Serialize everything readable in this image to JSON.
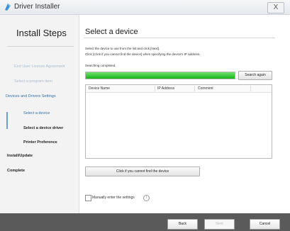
{
  "window": {
    "title": "Driver Installer",
    "close_label": "X"
  },
  "sidebar": {
    "title": "Install Steps",
    "steps": [
      {
        "label": "End User License Agreement",
        "state": "done"
      },
      {
        "label": "Select a program item",
        "state": "done"
      },
      {
        "label": "Devices and Drivers Settings",
        "state": "active-section"
      },
      {
        "label": "Select a device",
        "state": "current"
      },
      {
        "label": "Select a device driver",
        "state": "pending"
      },
      {
        "label": "Printer Preference",
        "state": "pending"
      },
      {
        "label": "Install/Update",
        "state": "pending"
      },
      {
        "label": "Complete",
        "state": "pending"
      }
    ]
  },
  "main": {
    "title": "Select a device",
    "instructions": [
      "Select the device to use from the list and click [Next].",
      "Click [Click if you cannot find the device] when specifying the device's IP address."
    ],
    "status": "Searching completed.",
    "progress_fraction": 1.0,
    "search_again_label": "Search again",
    "table": {
      "columns": [
        "Device Name",
        "IP Address",
        "Comment"
      ],
      "rows": []
    },
    "find_device_label": "Click if you cannot find the device",
    "manual_checkbox_label": "Manually enter the settings",
    "manual_checkbox_checked": false,
    "info_icon": "i"
  },
  "footer": {
    "back_label": "Back",
    "next_label": "Next",
    "cancel_label": "Cancel"
  },
  "colors": {
    "progress": "#19b219",
    "footer": "#5a5a5a",
    "accent": "#3a6ea8"
  }
}
